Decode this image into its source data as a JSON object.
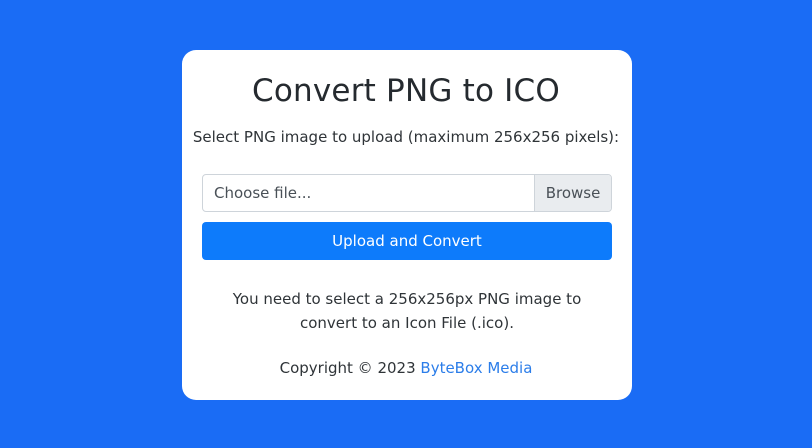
{
  "card": {
    "title": "Convert PNG to ICO",
    "subtitle": "Select PNG image to upload (maximum 256x256 pixels):",
    "file_input": {
      "placeholder": "Choose file...",
      "browse_label": "Browse"
    },
    "upload_button_label": "Upload and Convert",
    "info_text": "You need to select a 256x256px PNG image to convert to an Icon File (.ico).",
    "footer": {
      "copyright_text": "Copyright © 2023",
      "link_text": "ByteBox Media"
    }
  },
  "colors": {
    "background": "#1a6cf5",
    "card": "#ffffff",
    "button": "#0d7bfb",
    "link": "#2b7de9"
  }
}
